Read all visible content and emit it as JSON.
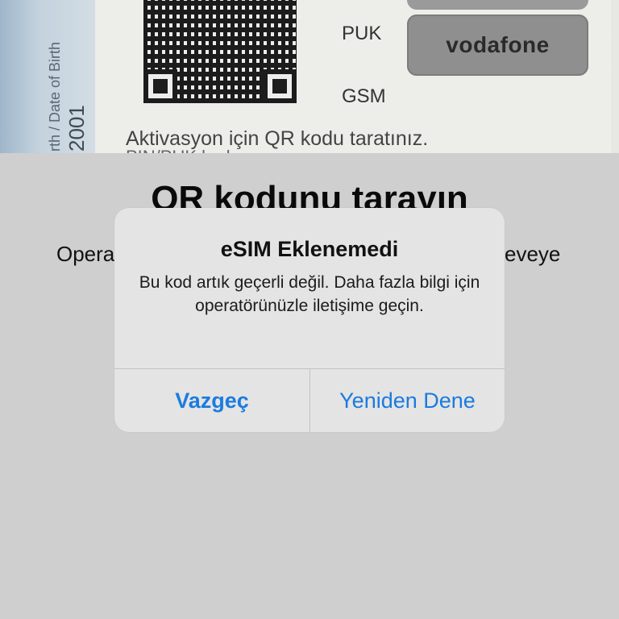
{
  "camera_preview": {
    "id_card_text_1": "rth / Date of Birth",
    "id_card_text_2": "2001",
    "label_puk": "PUK",
    "label_gsm": "GSM",
    "brand": "vodafone",
    "activation_line": "Aktivasyon için QR kodu taratınız.",
    "pin_puk_line": "PIN/PUK kodu"
  },
  "page": {
    "title": "QR kodunu tarayın",
    "subtitle_left": "Opera",
    "subtitle_right": "eveye"
  },
  "alert": {
    "title": "eSIM Eklenemedi",
    "message": "Bu kod artık geçerli değil. Daha fazla bilgi için operatörünüzle iletişime geçin.",
    "cancel_label": "Vazgeç",
    "retry_label": "Yeniden Dene"
  },
  "colors": {
    "accent": "#1a7be0",
    "alert_background": "#e4e4e4",
    "screen_background": "#cfcfcf"
  }
}
